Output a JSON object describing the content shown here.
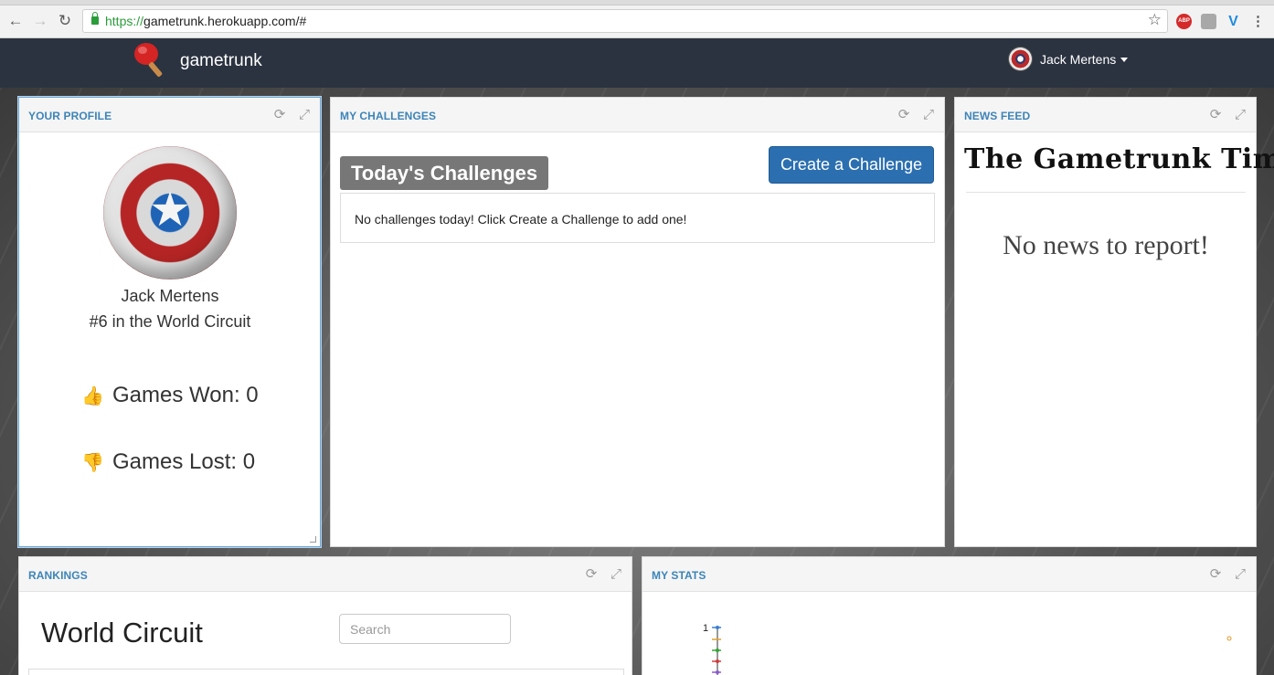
{
  "browser": {
    "url": "https://gametrunk.herokuapp.com/#",
    "url_scheme": "https://",
    "url_rest": "gametrunk.herokuapp.com/#"
  },
  "navbar": {
    "brand": "gametrunk",
    "user_name": "Jack Mertens"
  },
  "profile": {
    "title": "YOUR PROFILE",
    "name": "Jack Mertens",
    "rank": "#6 in the World Circuit",
    "games_won": "Games Won: 0",
    "games_lost": "Games Lost: 0"
  },
  "challenges": {
    "title": "MY CHALLENGES",
    "heading": "Today's Challenges",
    "create_button": "Create a Challenge",
    "empty_message": "No challenges today! Click Create a Challenge to add one!"
  },
  "news": {
    "title": "NEWS FEED",
    "masthead": "The Gametrunk Times",
    "empty_message": "No news to report!"
  },
  "rankings": {
    "title": "RANKINGS",
    "heading": "World Circuit",
    "search_placeholder": "Search"
  },
  "stats": {
    "title": "MY STATS",
    "y_tick": "1"
  },
  "colors": {
    "navbar": "#2b3340",
    "panel_title": "#3d84b8",
    "primary_button": "#2b6fb0"
  }
}
